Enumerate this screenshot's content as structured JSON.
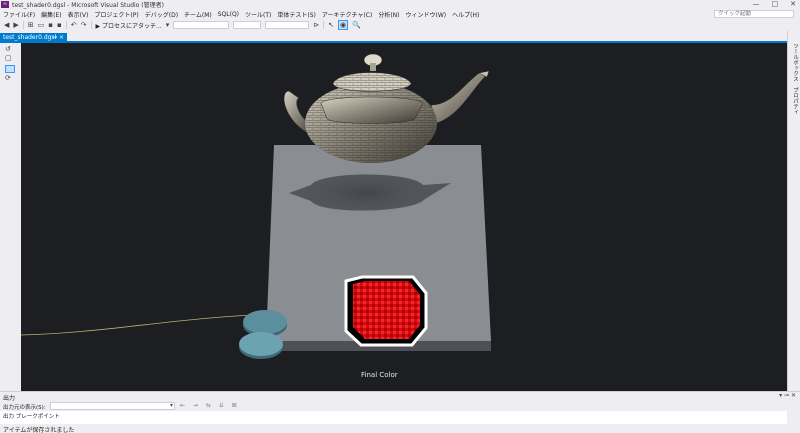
{
  "window": {
    "title": "test_shader0.dgsl - Microsoft Visual Studio (管理者)",
    "minimize_glyph": "—",
    "maximize_glyph": "□",
    "close_glyph": "✕"
  },
  "menu": {
    "items": [
      "ファイル(F)",
      "編集(E)",
      "表示(V)",
      "プロジェクト(P)",
      "デバッグ(D)",
      "チーム(M)",
      "SQL(Q)",
      "ツール(T)",
      "単体テスト(S)",
      "アーキテクチャ(C)",
      "分析(N)",
      "ウィンドウ(W)",
      "ヘルプ(H)"
    ],
    "quick_launch_placeholder": "クイック起動"
  },
  "toolbar": {
    "attach_label": "▶ プロセスにアタッチ...",
    "attach_dropdown": "▾"
  },
  "tabs": [
    {
      "label": "test_shader0.dgsl",
      "pin": "⊸",
      "close": "×"
    }
  ],
  "right_rail": {
    "toolbox": "ツールボックス",
    "properties": "プロパティ"
  },
  "viewport": {
    "node_label": "Final Color"
  },
  "output": {
    "title": "出力",
    "source_label": "出力元の表示(S):",
    "line": "出力  ブレークポイント",
    "controls": "▾  ⊸  ✕",
    "tools": "⇤ ⇥ ⇆ ⇊ ⊠"
  },
  "status": {
    "text": "アイテムが保存されました"
  },
  "colors": {
    "accent": "#007acc",
    "viewport_bg": "#1d1e22"
  }
}
